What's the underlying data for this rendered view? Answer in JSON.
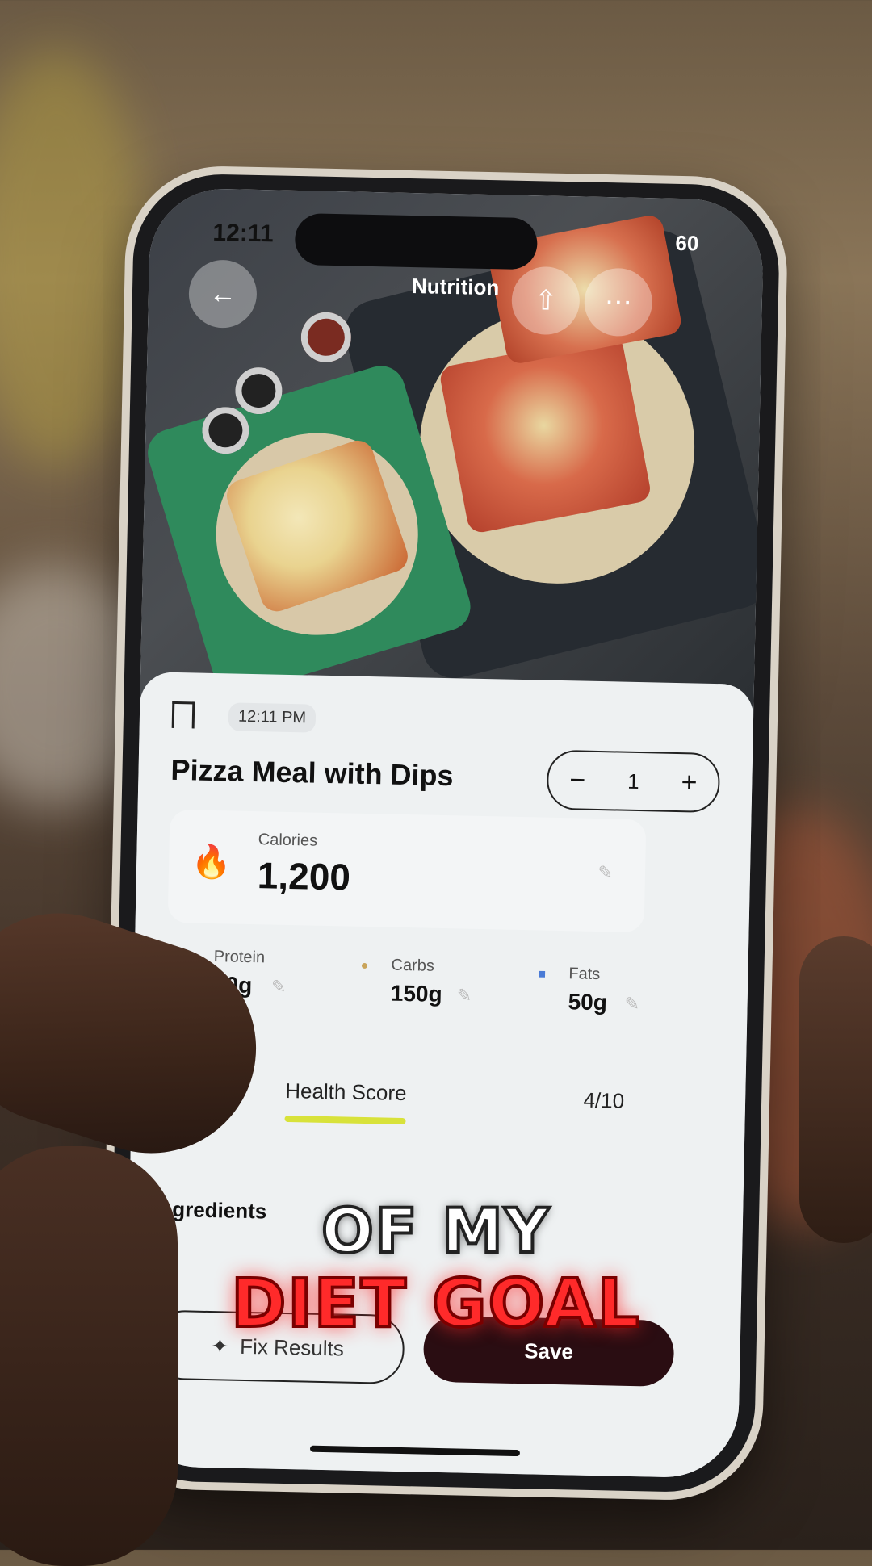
{
  "status_bar": {
    "time": "12:11",
    "battery": "60"
  },
  "header": {
    "title": "Nutrition",
    "back_icon": "arrow-left-icon",
    "share_icon": "share-icon",
    "more_icon": "more-icon"
  },
  "entry": {
    "time": "12:11 PM",
    "title": "Pizza Meal with Dips",
    "quantity": "1",
    "minus": "−",
    "plus": "+"
  },
  "calories": {
    "label": "Calories",
    "value": "1,200"
  },
  "macros": [
    {
      "label": "Protein",
      "value": "60g",
      "color": "#e0484a"
    },
    {
      "label": "Carbs",
      "value": "150g",
      "color": "#c9a45a"
    },
    {
      "label": "Fats",
      "value": "50g",
      "color": "#4a7bd6"
    }
  ],
  "health_score": {
    "label": "Health Score",
    "value": "4/10",
    "fraction": 0.4,
    "bar_color": "#d8e23a"
  },
  "ingredients": {
    "heading": "Ingredients"
  },
  "buttons": {
    "fix": "Fix Results",
    "save": "Save"
  },
  "caption": {
    "line1": "OF MY",
    "line2": "DIET GOAL"
  }
}
